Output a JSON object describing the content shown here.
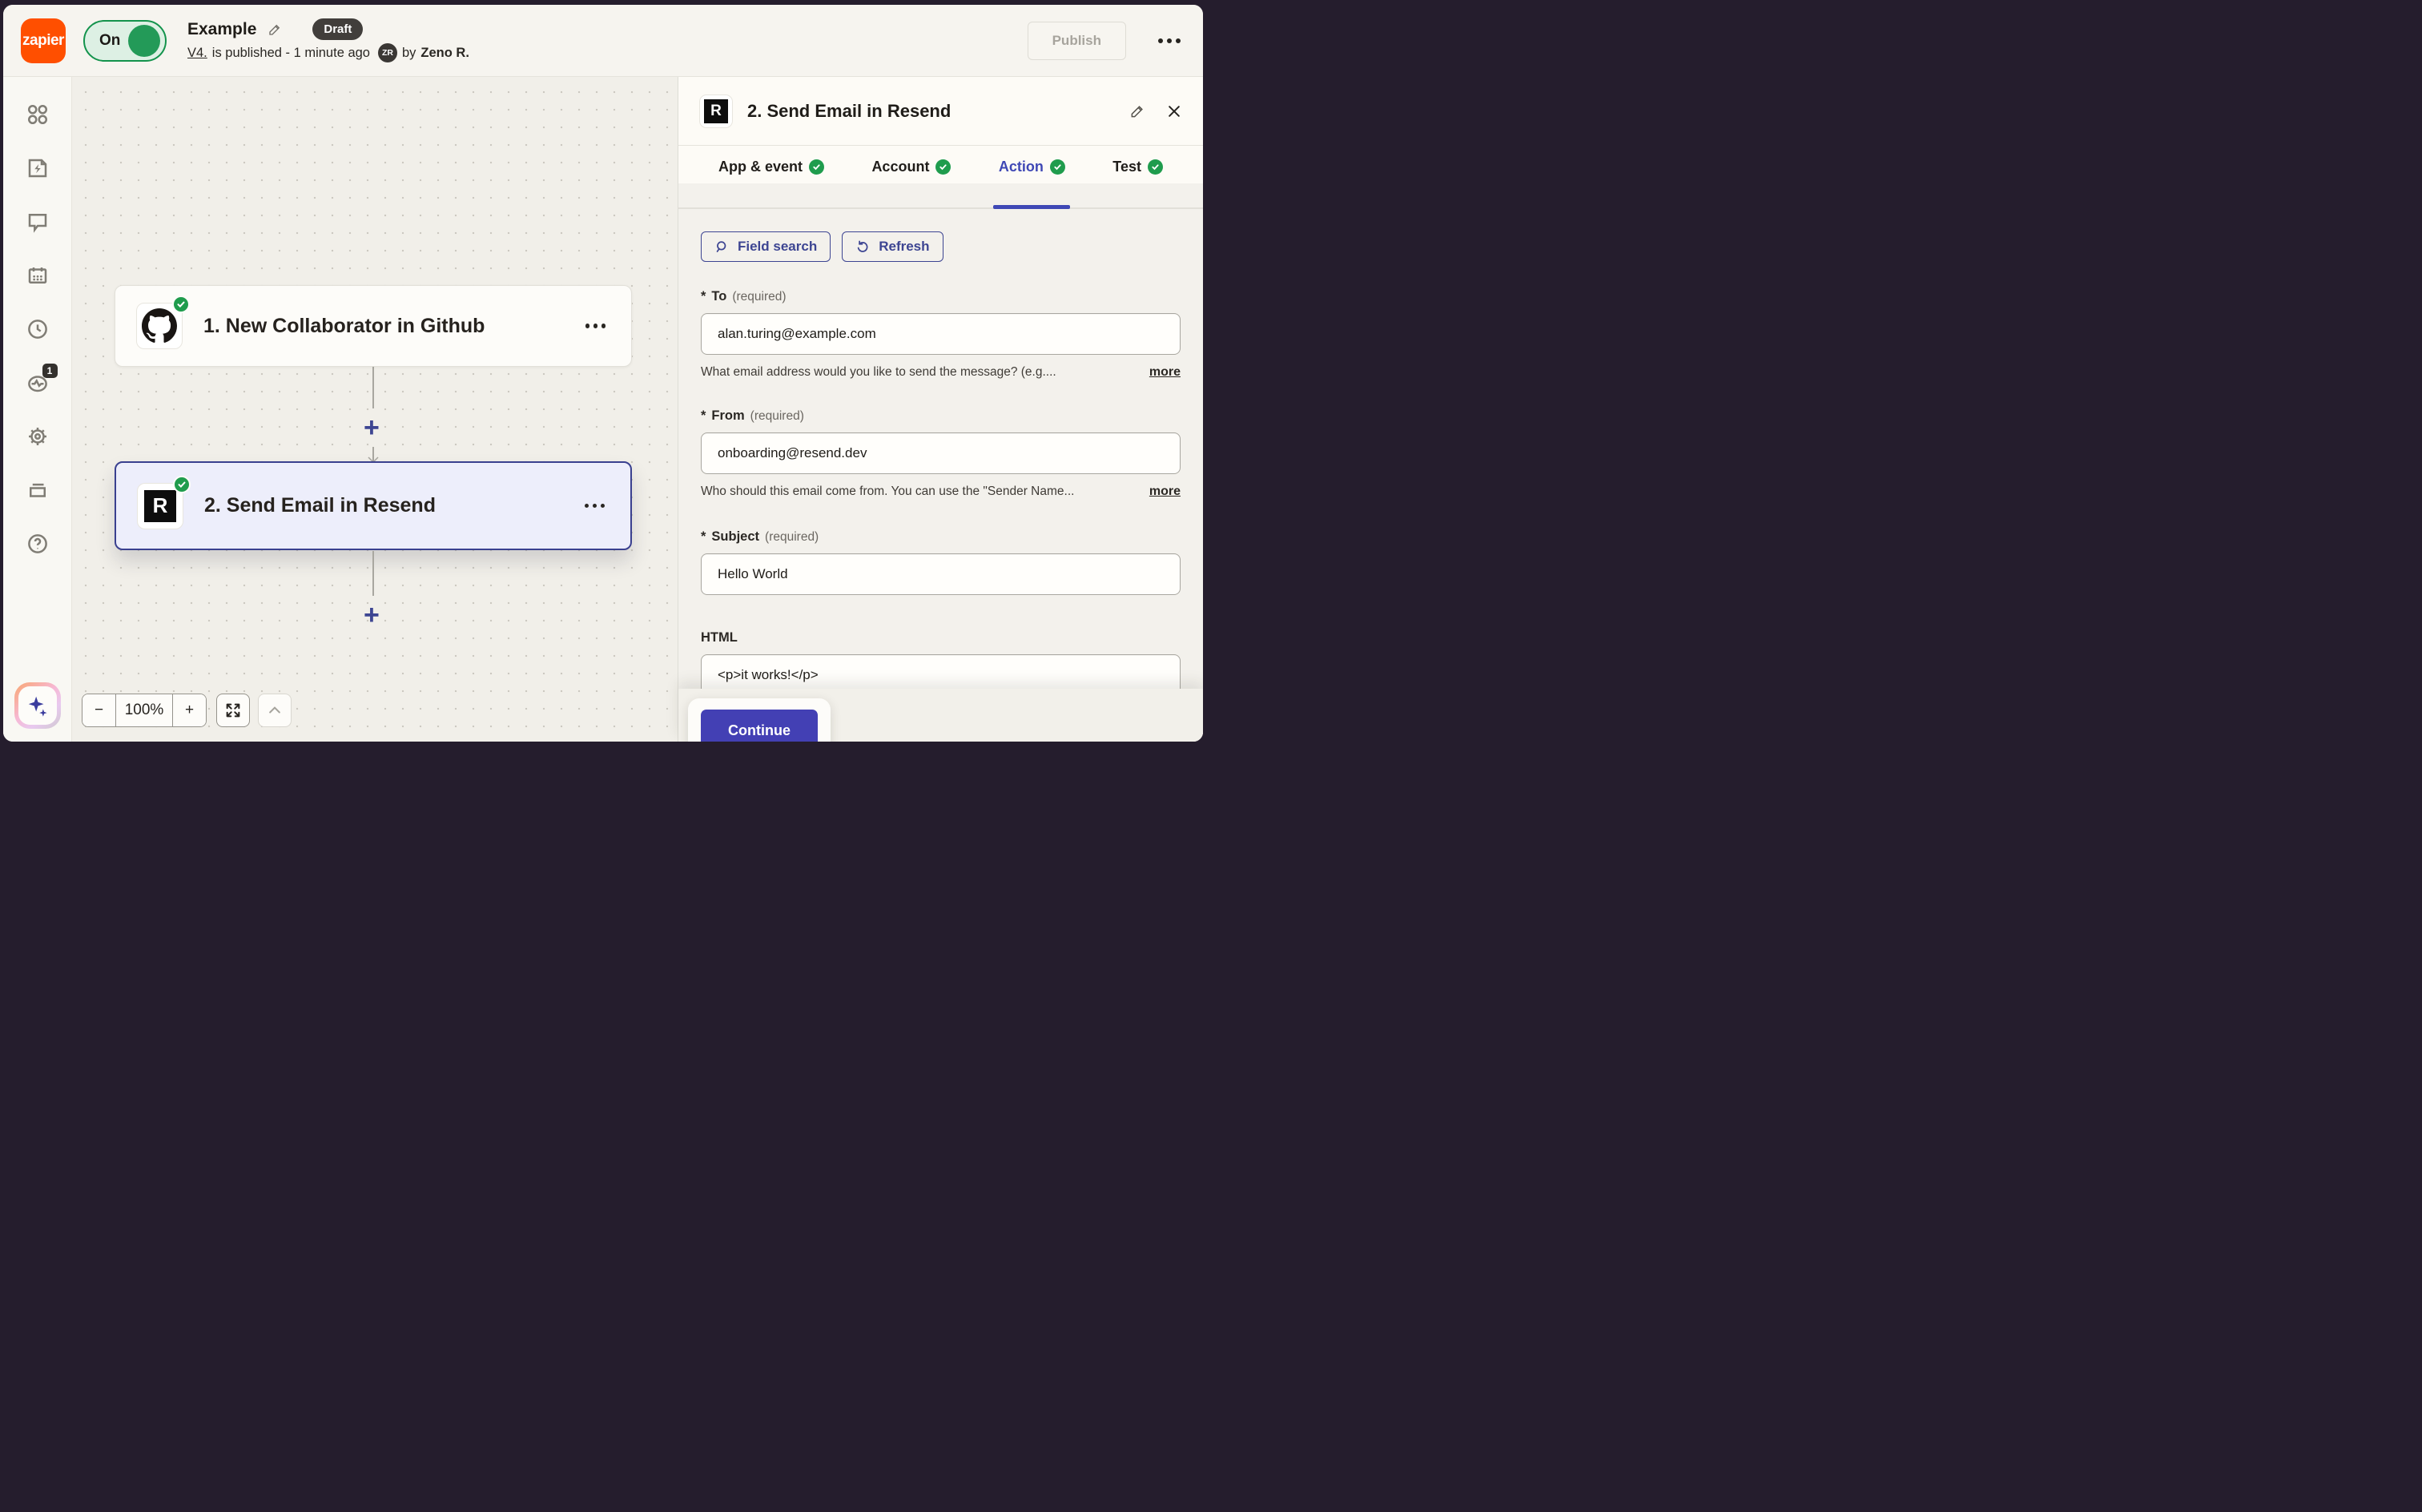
{
  "colors": {
    "brand_orange": "#ff4f00",
    "accent_indigo": "#3d4592",
    "continue_button": "#4340b4",
    "success_green": "#1f9c4d",
    "draft_badge": "#413e3b",
    "selected_card_bg": "#edeefb",
    "selected_card_border": "#3a408f"
  },
  "header": {
    "logo_text": "zapier",
    "toggle_label": "On",
    "title": "Example",
    "status_badge": "Draft",
    "version_link": "V4.",
    "published_text": "is published - 1 minute ago",
    "avatar_initials": "ZR",
    "by_label": "by",
    "author": "Zeno R.",
    "publish_label": "Publish"
  },
  "sidebar": {
    "items": [
      {
        "icon": "apps-grid-icon"
      },
      {
        "icon": "zap-document-icon"
      },
      {
        "icon": "chat-bubble-icon"
      },
      {
        "icon": "calendar-icon"
      },
      {
        "icon": "history-clock-icon"
      },
      {
        "icon": "activity-pulse-icon",
        "badge": "1"
      },
      {
        "icon": "gear-icon"
      },
      {
        "icon": "tray-stack-icon"
      },
      {
        "icon": "help-circle-icon"
      }
    ],
    "activity_badge": "1",
    "ai_button_icon": "sparkle-icon"
  },
  "canvas": {
    "steps": [
      {
        "title": "1. New Collaborator in Github",
        "app": "github",
        "status": "complete"
      },
      {
        "title": "2. Send Email in Resend",
        "app": "resend",
        "status": "complete",
        "selected": true
      }
    ],
    "resend_letter": "R",
    "zoom_level": "100%",
    "zoom_out_label": "−",
    "zoom_in_label": "+",
    "add_step_label": "+"
  },
  "panel": {
    "title": "2. Send Email in Resend",
    "tile_letter": "R",
    "tabs": [
      {
        "label": "App & event",
        "complete": true
      },
      {
        "label": "Account",
        "complete": true
      },
      {
        "label": "Action",
        "complete": true,
        "active": true
      },
      {
        "label": "Test",
        "complete": true
      }
    ],
    "toolbar": {
      "field_search_label": "Field search",
      "refresh_label": "Refresh"
    },
    "fields": [
      {
        "star": "*",
        "label": "To",
        "required": "(required)",
        "value": "alan.turing@example.com",
        "help": "What email address would you like to send the message? (e.g....",
        "more": "more"
      },
      {
        "star": "*",
        "label": "From",
        "required": "(required)",
        "value": "onboarding@resend.dev",
        "help": "Who should this email come from. You can use the \"Sender Name...",
        "more": "more"
      },
      {
        "star": "*",
        "label": "Subject",
        "required": "(required)",
        "value": "Hello World"
      },
      {
        "label": "HTML",
        "value": "<p>it works!</p>"
      }
    ],
    "continue_label": "Continue"
  }
}
